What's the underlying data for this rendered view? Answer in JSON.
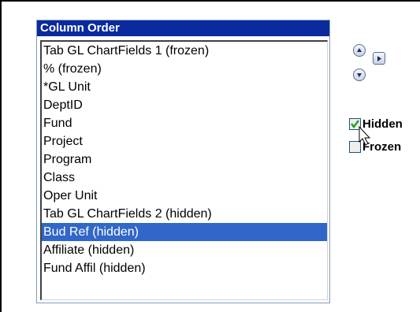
{
  "column_order": {
    "title": "Column Order",
    "items": [
      {
        "label": "Tab GL ChartFields 1 (frozen)",
        "selected": false
      },
      {
        "label": "% (frozen)",
        "selected": false
      },
      {
        "label": "*GL Unit",
        "selected": false
      },
      {
        "label": "DeptID",
        "selected": false
      },
      {
        "label": "Fund",
        "selected": false
      },
      {
        "label": "Project",
        "selected": false
      },
      {
        "label": "Program",
        "selected": false
      },
      {
        "label": "Class",
        "selected": false
      },
      {
        "label": "Oper Unit",
        "selected": false
      },
      {
        "label": "Tab GL ChartFields 2 (hidden)",
        "selected": false
      },
      {
        "label": "Bud Ref (hidden)",
        "selected": true
      },
      {
        "label": "Affiliate (hidden)",
        "selected": false
      },
      {
        "label": "Fund Affil (hidden)",
        "selected": false
      }
    ]
  },
  "options": {
    "hidden": {
      "label": "Hidden",
      "checked": true
    },
    "frozen": {
      "label": "Frozen",
      "checked": false
    }
  },
  "icons": {
    "move_up": "move-up-icon",
    "move_down": "move-down-icon",
    "move_right": "move-right-icon"
  },
  "colors": {
    "header_bg": "#0a2a9e",
    "selection_bg": "#3167c8",
    "check_mark": "#21a121"
  }
}
